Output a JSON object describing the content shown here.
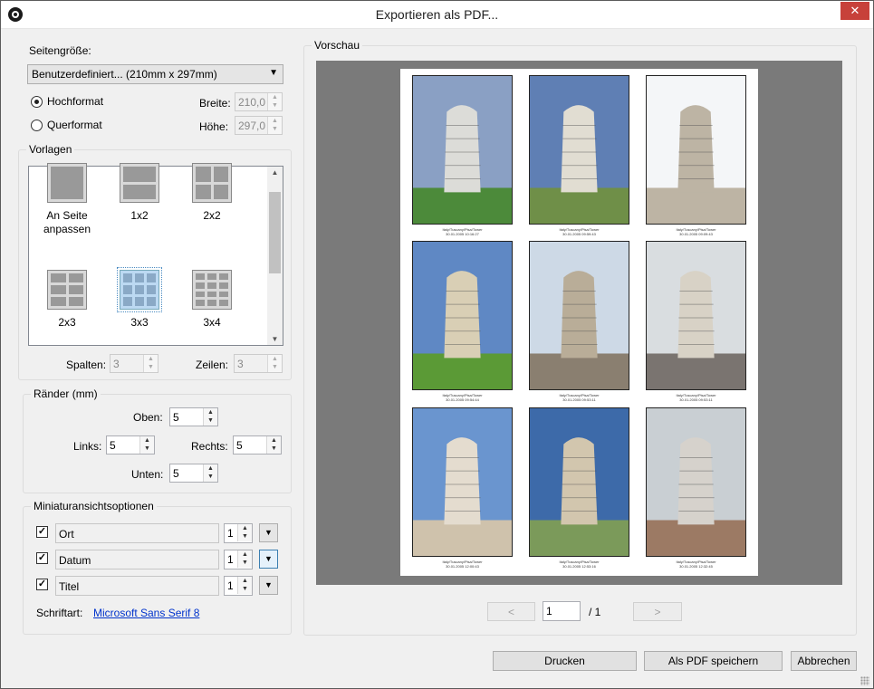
{
  "window": {
    "title": "Exportieren als PDF..."
  },
  "page_size": {
    "label": "Seitengröße:",
    "selected": "Benutzerdefiniert... (210mm x 297mm)",
    "portrait_label": "Hochformat",
    "landscape_label": "Querformat",
    "width_label": "Breite:",
    "width_value": "210,0",
    "height_label": "Höhe:",
    "height_value": "297,0"
  },
  "templates": {
    "legend": "Vorlagen",
    "items": [
      {
        "label": "An Seite anpassen",
        "cols": 1,
        "rows": 1
      },
      {
        "label": "1x2",
        "cols": 1,
        "rows": 2
      },
      {
        "label": "2x2",
        "cols": 2,
        "rows": 2
      },
      {
        "label": "2x3",
        "cols": 2,
        "rows": 3
      },
      {
        "label": "3x3",
        "cols": 3,
        "rows": 3,
        "selected": true
      },
      {
        "label": "3x4",
        "cols": 3,
        "rows": 4
      }
    ],
    "columns_label": "Spalten:",
    "columns_value": "3",
    "rows_label": "Zeilen:",
    "rows_value": "3"
  },
  "margins": {
    "legend": "Ränder (mm)",
    "top_label": "Oben:",
    "top_value": "5",
    "left_label": "Links:",
    "left_value": "5",
    "right_label": "Rechts:",
    "right_value": "5",
    "bottom_label": "Unten:",
    "bottom_value": "5"
  },
  "thumb_options": {
    "legend": "Miniaturansichtsoptionen",
    "rows": [
      {
        "label": "Ort",
        "checked": true,
        "lines": "1"
      },
      {
        "label": "Datum",
        "checked": true,
        "lines": "1"
      },
      {
        "label": "Titel",
        "checked": true,
        "lines": "1"
      }
    ],
    "font_label": "Schriftart:",
    "font_value": "Microsoft Sans Serif 8"
  },
  "preview": {
    "legend": "Vorschau",
    "caption_location": "Italy/Tuscany/Pisa/Tower",
    "thumbs": [
      {
        "date": "30.01.2005 10:16:27"
      },
      {
        "date": "30.01.2005 09:59:43"
      },
      {
        "date": "30.01.2005 09:09:43"
      },
      {
        "date": "30.01.2005 09:54:44"
      },
      {
        "date": "30.01.2005 09:53:11"
      },
      {
        "date": "30.01.2005 09:53:11"
      },
      {
        "date": "30.01.2005 12:00:43"
      },
      {
        "date": "30.01.2005 12:53:16"
      },
      {
        "date": "30.01.2005 12:32:45"
      }
    ],
    "prev_label": "<",
    "next_label": ">",
    "page_value": "1",
    "page_total": "/ 1"
  },
  "buttons": {
    "print": "Drucken",
    "save_pdf": "Als PDF speichern",
    "cancel": "Abbrechen"
  },
  "colors": {
    "close": "#c7413a",
    "link": "#0033cc",
    "preview_bg": "#7a7a7a"
  },
  "icons": {
    "close": "close-icon",
    "app": "app-logo-icon"
  }
}
